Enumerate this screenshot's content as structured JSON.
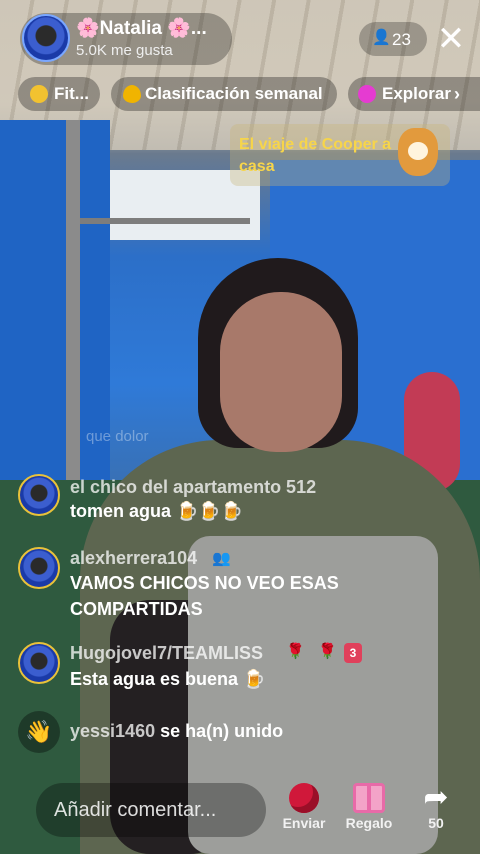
{
  "host": {
    "name": "🌸Natalia 🌸...",
    "likes": "5.0K me gusta",
    "viewer_count": "23"
  },
  "chips": [
    {
      "label": "Fit...",
      "icon": "gold-coin-icon"
    },
    {
      "label": "Clasificación semanal",
      "icon": "flame-icon"
    },
    {
      "label": "Explorar",
      "icon": "pink-orb-icon"
    }
  ],
  "promo": {
    "text": "El viaje de Cooper a casa",
    "icon": "cooper-dog-icon"
  },
  "faded_comment": "que dolor",
  "comments": [
    {
      "user": "el chico del apartamento 512",
      "message": "tomen agua 🍺🍺🍺"
    },
    {
      "user": "alexherrera104",
      "message": "VAMOS CHICOS NO VEO ESAS COMPARTIDAS"
    },
    {
      "user": "Hugojovel7/TEAMLISS",
      "message": "Esta agua es buena 🍺",
      "badge_level": "3"
    }
  ],
  "join": {
    "user": "yessi1460",
    "text": "se ha(n) unido"
  },
  "bottom": {
    "placeholder": "Añadir comentar...",
    "send_label": "Enviar",
    "gift_label": "Regalo",
    "share_count": "50"
  },
  "colors": {
    "promo_text": "#f7d54a",
    "rose": "#d0183a",
    "gift": "#f3a3c8"
  }
}
